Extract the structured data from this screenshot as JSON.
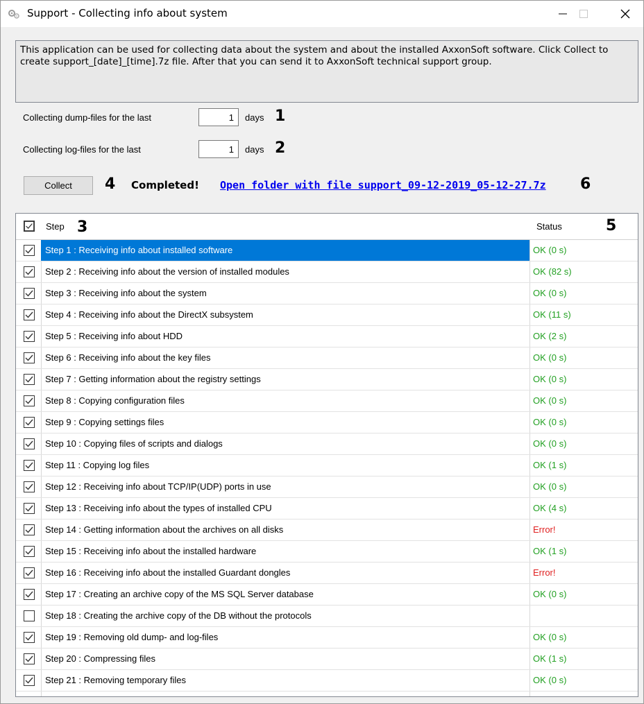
{
  "window": {
    "title": "Support - Collecting info about system"
  },
  "info": {
    "text": "This application can be used for collecting data about the system and about the installed AxxonSoft software. Click Collect to create support_[date]_[time].7z file. After that you can send it to AxxonSoft technical support group."
  },
  "dump": {
    "label": "Collecting dump-files for the last",
    "value": "1",
    "unit": "days",
    "badge": "1"
  },
  "log": {
    "label": "Collecting log-files for the last",
    "value": "1",
    "unit": "days",
    "badge": "2"
  },
  "actions": {
    "collect_label": "Collect",
    "collect_badge": "4",
    "status_text": "Completed!",
    "link_text": "Open folder with file support_09-12-2019_05-12-27.7z",
    "link_badge": "6"
  },
  "grid": {
    "header_checked": true,
    "step_header": "Step",
    "step_badge": "3",
    "status_header": "Status",
    "status_badge": "5",
    "colors": {
      "ok": "#22a022",
      "error": "#e02020",
      "selected": "#0078d7"
    },
    "rows": [
      {
        "checked": true,
        "step": "Step 1 : Receiving info about installed software",
        "status": "OK (0 s)",
        "kind": "ok",
        "selected": true
      },
      {
        "checked": true,
        "step": "Step 2 : Receiving info about the version of installed modules",
        "status": "OK (82 s)",
        "kind": "ok"
      },
      {
        "checked": true,
        "step": "Step 3 : Receiving info about the system",
        "status": "OK (0 s)",
        "kind": "ok"
      },
      {
        "checked": true,
        "step": "Step 4 : Receiving info about the DirectX subsystem",
        "status": "OK (11 s)",
        "kind": "ok"
      },
      {
        "checked": true,
        "step": "Step 5 : Receiving info about HDD",
        "status": "OK (2 s)",
        "kind": "ok"
      },
      {
        "checked": true,
        "step": "Step 6 : Receiving info about the key files",
        "status": "OK (0 s)",
        "kind": "ok"
      },
      {
        "checked": true,
        "step": "Step 7 : Getting information about the registry settings",
        "status": "OK (0 s)",
        "kind": "ok"
      },
      {
        "checked": true,
        "step": "Step 8 : Copying configuration files",
        "status": "OK (0 s)",
        "kind": "ok"
      },
      {
        "checked": true,
        "step": "Step 9 : Copying settings files",
        "status": "OK (0 s)",
        "kind": "ok"
      },
      {
        "checked": true,
        "step": "Step 10 : Copying files of scripts and dialogs",
        "status": "OK (0 s)",
        "kind": "ok"
      },
      {
        "checked": true,
        "step": "Step 11 : Copying log files",
        "status": "OK (1 s)",
        "kind": "ok"
      },
      {
        "checked": true,
        "step": "Step 12 : Receiving info about TCP/IP(UDP) ports in use",
        "status": "OK (0 s)",
        "kind": "ok"
      },
      {
        "checked": true,
        "step": "Step 13 : Receiving info about the types of installed CPU",
        "status": "OK (4 s)",
        "kind": "ok"
      },
      {
        "checked": true,
        "step": "Step 14 : Getting information about the archives on all disks",
        "status": "Error!",
        "kind": "error"
      },
      {
        "checked": true,
        "step": "Step 15 : Receiving info about the installed hardware",
        "status": "OK (1 s)",
        "kind": "ok"
      },
      {
        "checked": true,
        "step": "Step 16 : Receiving info about the installed Guardant dongles",
        "status": "Error!",
        "kind": "error"
      },
      {
        "checked": true,
        "step": "Step 17 : Creating an archive copy of the MS SQL Server database",
        "status": "OK (0 s)",
        "kind": "ok"
      },
      {
        "checked": false,
        "step": "Step 18 : Creating the archive copy of the DB without the protocols",
        "status": "",
        "kind": "none"
      },
      {
        "checked": true,
        "step": "Step 19 : Removing old dump- and log-files",
        "status": "OK (0 s)",
        "kind": "ok"
      },
      {
        "checked": true,
        "step": "Step 20 : Compressing files",
        "status": "OK (1 s)",
        "kind": "ok"
      },
      {
        "checked": true,
        "step": "Step 21 : Removing temporary files",
        "status": "OK (0 s)",
        "kind": "ok"
      }
    ]
  }
}
